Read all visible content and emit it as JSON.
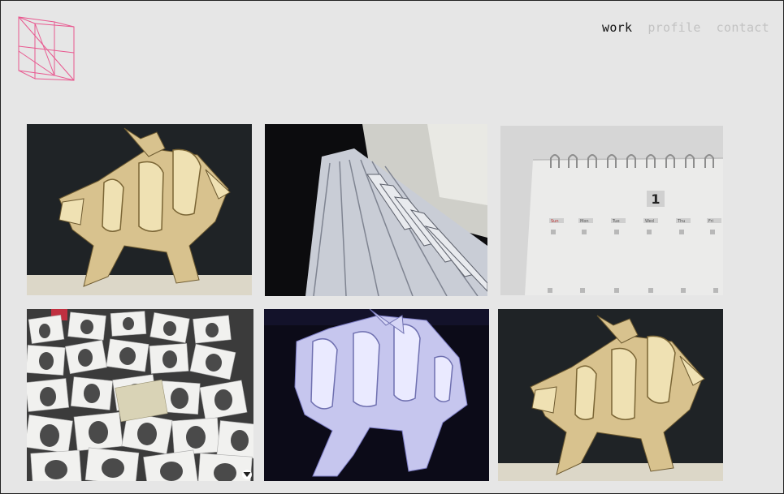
{
  "site": {
    "logo_icon": "n-wireframe-logo-icon",
    "accent_color": "#e8588f"
  },
  "nav": {
    "items": [
      {
        "label": "work",
        "active": true
      },
      {
        "label": "profile",
        "active": false
      },
      {
        "label": "contact",
        "active": false
      }
    ]
  },
  "gallery": {
    "thumbnails": [
      {
        "subject": "wooden gothic letter sculpture on black backdrop"
      },
      {
        "subject": "white paper piano keyboard"
      },
      {
        "subject": "white paper desk calendar"
      },
      {
        "subject": "pineapple drawings spread on table"
      },
      {
        "subject": "white paper gothic letter sculpture in blue light"
      },
      {
        "subject": "wooden gothic letter sculpture on black backdrop"
      }
    ],
    "scroll_icon": "chevron-down-icon"
  },
  "calendar_text": {
    "date": "1",
    "weekdays": [
      "Sun",
      "Mon",
      "Tue",
      "Wed",
      "Thu",
      "Fri"
    ]
  }
}
